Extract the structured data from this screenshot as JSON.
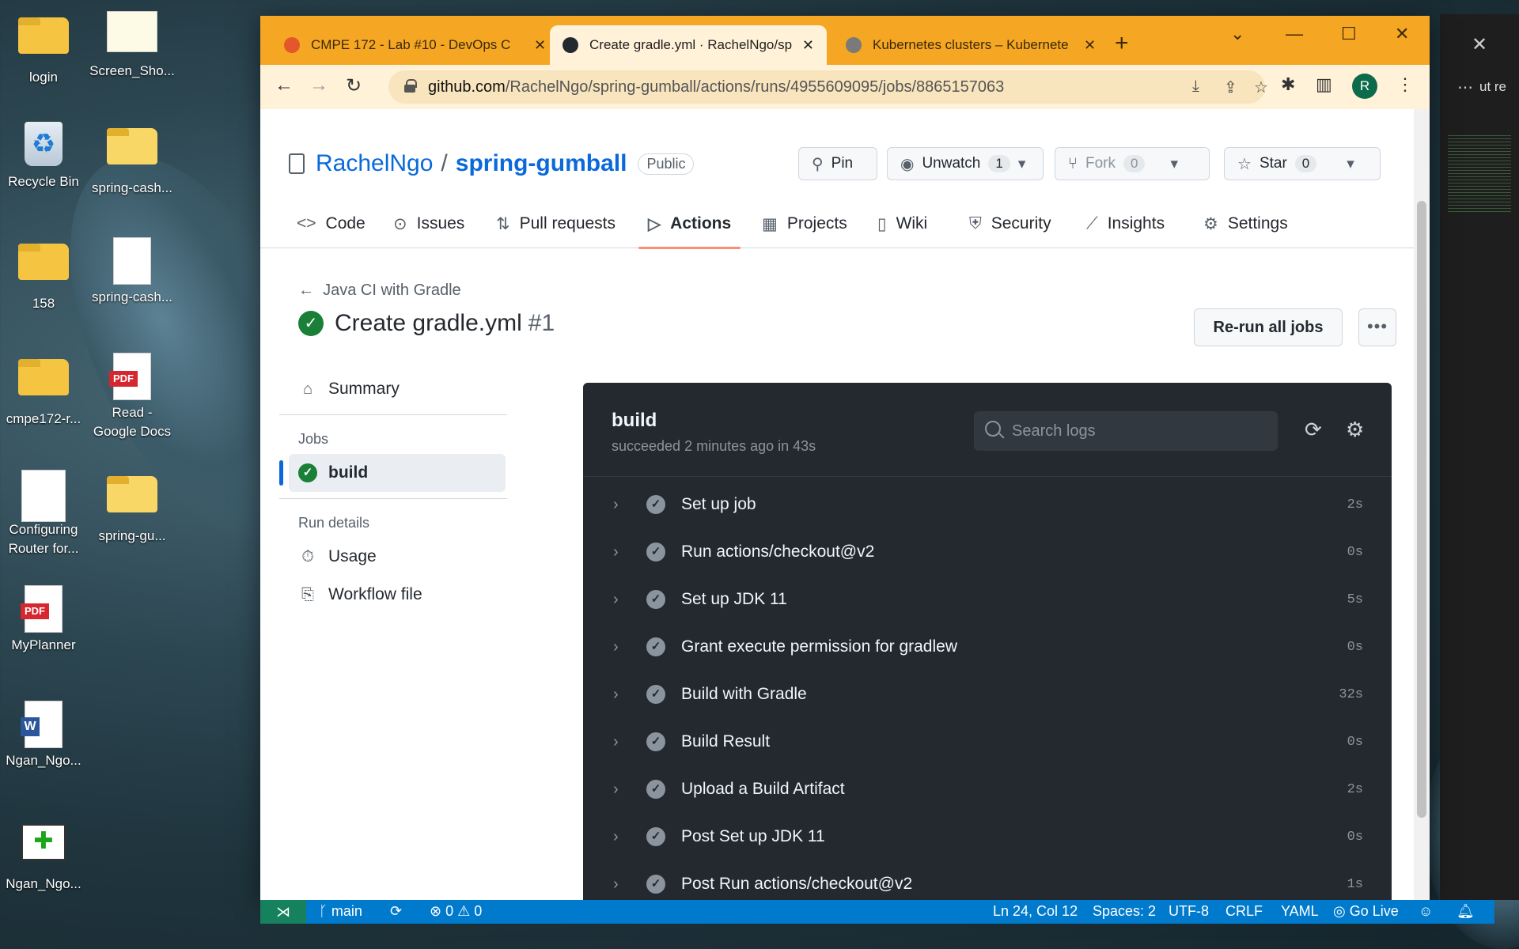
{
  "desktop": {
    "icons": [
      {
        "label": "login"
      },
      {
        "label": "Screen_Sho..."
      },
      {
        "label": "Recycle Bin"
      },
      {
        "label": "spring-cash..."
      },
      {
        "label": "158"
      },
      {
        "label": "spring-cash..."
      },
      {
        "label": "cmpe172-r..."
      },
      {
        "label": "Read - Google Docs"
      },
      {
        "label": "Configuring Router for..."
      },
      {
        "label": "spring-gu..."
      },
      {
        "label": "MyPlanner"
      },
      {
        "label": "Ngan_Ngo..."
      },
      {
        "label": "Ngan_Ngo..."
      }
    ],
    "bg_window_text": "ut re"
  },
  "browser": {
    "tabs": [
      {
        "title": "CMPE 172 - Lab #10 - DevOps C",
        "icon_color": "#e2572c"
      },
      {
        "title": "Create gradle.yml · RachelNgo/sp",
        "icon_color": "#24292f"
      },
      {
        "title": "Kubernetes clusters – Kubernete",
        "icon_color": "#7a7a7a"
      }
    ],
    "url_host": "github.com",
    "url_path": "/RachelNgo/spring-gumball/actions/runs/4955609095/jobs/8865157063",
    "avatar_letter": "R"
  },
  "repo": {
    "owner": "RachelNgo",
    "separator": "/",
    "name": "spring-gumball",
    "visibility": "Public",
    "pin_label": "Pin",
    "unwatch_label": "Unwatch",
    "unwatch_count": "1",
    "fork_label": "Fork",
    "fork_count": "0",
    "star_label": "Star",
    "star_count": "0"
  },
  "nav": {
    "items": [
      {
        "label": "Code",
        "icon": "code-icon"
      },
      {
        "label": "Issues",
        "icon": "issue-icon"
      },
      {
        "label": "Pull requests",
        "icon": "pull-request-icon"
      },
      {
        "label": "Actions",
        "icon": "play-icon"
      },
      {
        "label": "Projects",
        "icon": "table-icon"
      },
      {
        "label": "Wiki",
        "icon": "book-icon"
      },
      {
        "label": "Security",
        "icon": "shield-icon"
      },
      {
        "label": "Insights",
        "icon": "graph-icon"
      },
      {
        "label": "Settings",
        "icon": "gear-icon"
      }
    ]
  },
  "run": {
    "back_label": "Java CI with Gradle",
    "title": "Create gradle.yml",
    "number": "#1",
    "rerun_label": "Re-run all jobs"
  },
  "sidebar": {
    "summary_label": "Summary",
    "jobs_heading": "Jobs",
    "job_name": "build",
    "run_details_heading": "Run details",
    "usage_label": "Usage",
    "workflow_file_label": "Workflow file"
  },
  "job": {
    "title": "build",
    "subtitle": "succeeded 2 minutes ago in 43s",
    "search_placeholder": "Search logs",
    "steps": [
      {
        "name": "Set up job",
        "duration": "2s"
      },
      {
        "name": "Run actions/checkout@v2",
        "duration": "0s"
      },
      {
        "name": "Set up JDK 11",
        "duration": "5s"
      },
      {
        "name": "Grant execute permission for gradlew",
        "duration": "0s"
      },
      {
        "name": "Build with Gradle",
        "duration": "32s"
      },
      {
        "name": "Build Result",
        "duration": "0s"
      },
      {
        "name": "Upload a Build Artifact",
        "duration": "2s"
      },
      {
        "name": "Post Set up JDK 11",
        "duration": "0s"
      },
      {
        "name": "Post Run actions/checkout@v2",
        "duration": "1s"
      }
    ]
  },
  "statusbar": {
    "branch": "main",
    "errors": "0",
    "warnings": "0",
    "position": "Ln 24, Col 12",
    "spaces": "Spaces: 2",
    "encoding": "UTF-8",
    "eol": "CRLF",
    "language": "YAML",
    "golive": "Go Live"
  },
  "colors": {
    "tabstrip": "#f5a623",
    "accent_blue": "#0969da",
    "success_green": "#1a7f37",
    "log_bg": "#24292f",
    "statusbar": "#007acc"
  }
}
